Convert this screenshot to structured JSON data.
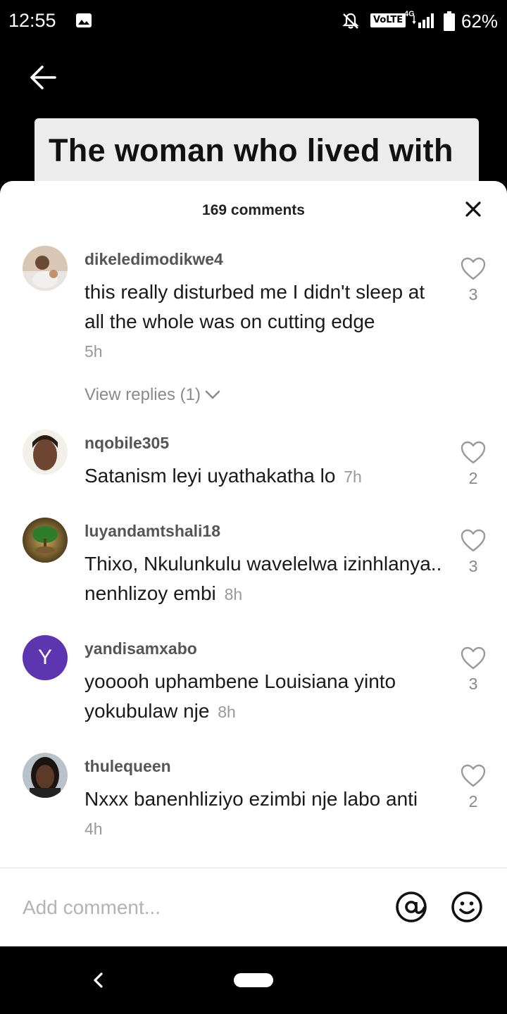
{
  "status_bar": {
    "time": "12:55",
    "volte": "VoLTE",
    "network": "4G",
    "battery": "62%"
  },
  "video": {
    "caption": "The woman who lived with"
  },
  "sheet": {
    "title": "169 comments"
  },
  "comments": [
    {
      "username": "dikeledimodikwe4",
      "text": "this really disturbed me I didn't sleep at all the whole was on cutting edge",
      "time": "5h",
      "likes": "3",
      "view_replies": "View replies (1)"
    },
    {
      "username": "nqobile305",
      "text": "Satanism leyi uyathakatha lo",
      "time": "7h",
      "likes": "2"
    },
    {
      "username": "luyandamtshali18",
      "text": "Thixo, Nkulunkulu wavelelwa izinhlanya.. nenhlizoy embi",
      "time": "8h",
      "likes": "3"
    },
    {
      "username": "yandisamxabo",
      "avatar_initial": "Y",
      "avatar_color": "#5e35b1",
      "text": "yooooh uphambene Louisiana yinto yokubulaw nje",
      "time": "8h",
      "likes": "3"
    },
    {
      "username": "thulequeen",
      "text": "Nxxx banenhliziyo ezimbi nje labo anti",
      "time": "4h",
      "likes": "2"
    }
  ],
  "composer": {
    "placeholder": "Add comment..."
  },
  "icons": {
    "back": "arrow-left-icon",
    "close": "close-icon",
    "like": "heart-outline-icon",
    "mention": "at-sign-icon",
    "emoji": "smiley-icon"
  }
}
